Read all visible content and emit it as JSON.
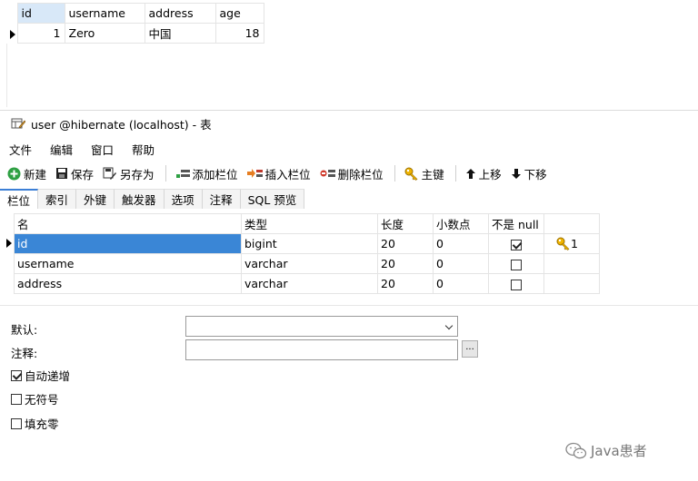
{
  "result_grid": {
    "headers": [
      "id",
      "username",
      "address",
      "age"
    ],
    "row": {
      "id": "1",
      "username": "Zero",
      "address": "中国",
      "age": "18"
    }
  },
  "window": {
    "title": "user @hibernate (localhost) - 表"
  },
  "menu": [
    "文件",
    "编辑",
    "窗口",
    "帮助"
  ],
  "toolbar": {
    "new": "新建",
    "save": "保存",
    "save_as": "另存为",
    "add_field": "添加栏位",
    "insert_field": "插入栏位",
    "delete_field": "删除栏位",
    "primary_key": "主键",
    "move_up": "上移",
    "move_down": "下移"
  },
  "tabs": [
    "栏位",
    "索引",
    "外键",
    "触发器",
    "选项",
    "注释",
    "SQL 预览"
  ],
  "fields": {
    "headers": [
      "名",
      "类型",
      "长度",
      "小数点",
      "不是 null",
      ""
    ],
    "rows": [
      {
        "name": "id",
        "type": "bigint",
        "length": "20",
        "decimals": "0",
        "not_null": true,
        "key": "1"
      },
      {
        "name": "username",
        "type": "varchar",
        "length": "20",
        "decimals": "0",
        "not_null": false,
        "key": ""
      },
      {
        "name": "address",
        "type": "varchar",
        "length": "20",
        "decimals": "0",
        "not_null": false,
        "key": ""
      }
    ]
  },
  "properties": {
    "default_label": "默认:",
    "comment_label": "注释:",
    "comment_button": "...",
    "auto_increment": {
      "label": "自动递增",
      "checked": true
    },
    "unsigned": {
      "label": "无符号",
      "checked": false
    },
    "zerofill": {
      "label": "填充零",
      "checked": false
    }
  },
  "watermark": "Java患者",
  "colors": {
    "selection": "#3a86d6",
    "header_select": "#d8e8f8",
    "tab_accent": "#3c7fd6"
  }
}
